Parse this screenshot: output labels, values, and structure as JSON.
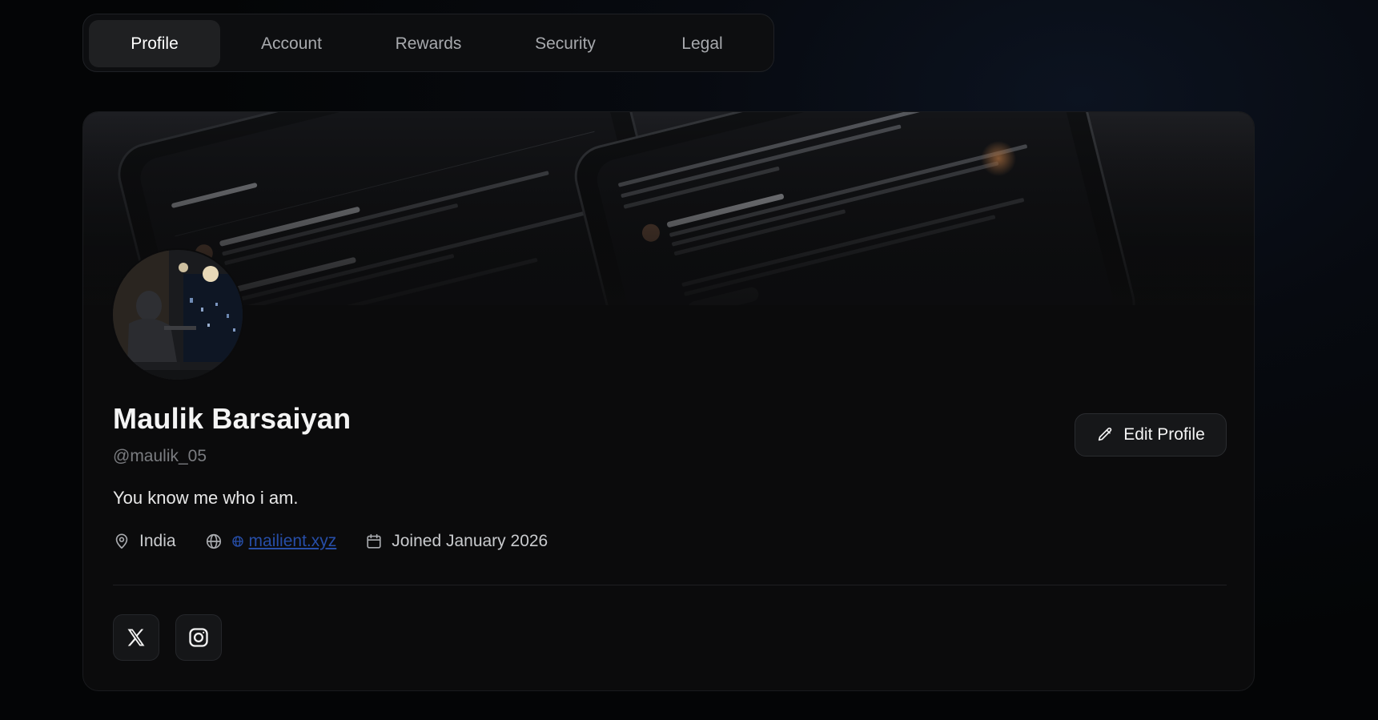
{
  "tabs": [
    {
      "label": "Profile",
      "active": true
    },
    {
      "label": "Account",
      "active": false
    },
    {
      "label": "Rewards",
      "active": false
    },
    {
      "label": "Security",
      "active": false
    },
    {
      "label": "Legal",
      "active": false
    }
  ],
  "profile": {
    "name": "Maulik Barsaiyan",
    "handle": "@maulik_05",
    "bio": "You know me who i am.",
    "location": "India",
    "website": "mailient.xyz",
    "joined": "Joined January 2026",
    "edit_label": "Edit Profile"
  },
  "icons": {
    "location": "map-pin-icon",
    "website": "globe-icon",
    "joined": "calendar-icon",
    "edit": "pencil-icon",
    "social": [
      "x-logo-icon",
      "instagram-icon"
    ]
  },
  "colors": {
    "background": "#050608",
    "card": "#0b0b0c",
    "active_tab": "#1f2022",
    "link": "#274ea8"
  }
}
